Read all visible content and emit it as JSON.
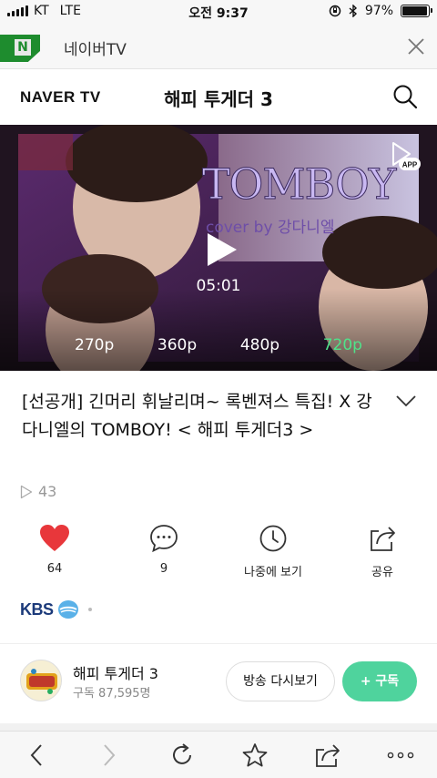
{
  "status_bar": {
    "carrier": "KT",
    "network": "LTE",
    "time": "오전 9:37",
    "battery": "97%",
    "battery_level": 0.97
  },
  "browser": {
    "logo_letter": "N",
    "title": "네이버TV"
  },
  "tv_header": {
    "logo": "NAVER TV",
    "title": "해피 투게더 3"
  },
  "video": {
    "overlay_title": "TOMBOY",
    "overlay_subtitle": "cover by 강다니엘",
    "duration": "05:01",
    "app_badge": "APP",
    "qualities": [
      "270p",
      "360p",
      "480p",
      "720p"
    ],
    "selected_quality": "720p"
  },
  "clip": {
    "title": "[선공개] 긴머리 휘날리며~ 록벤져스 특집! X 강 다니엘의 TOMBOY! < 해피 투게더3 >",
    "views": "43"
  },
  "actions": [
    {
      "name": "like",
      "label": "64"
    },
    {
      "name": "comment",
      "label": "9"
    },
    {
      "name": "watch-later",
      "label": "나중에 보기"
    },
    {
      "name": "share",
      "label": "공유"
    }
  ],
  "broadcaster": "KBS",
  "channel": {
    "name": "해피 투게더 3",
    "subscribers": "구독 87,595명",
    "replay_label": "방송 다시보기",
    "subscribe_label": "+ 구독"
  },
  "colors": {
    "accent_green": "#4fd39d",
    "quality_active": "#4fe38a",
    "like_red": "#e8373b",
    "naver_green": "#1e8c2e"
  },
  "toolbar": [
    "back-icon",
    "forward-icon",
    "refresh-icon",
    "bookmark-star-icon",
    "share-icon",
    "more-icon"
  ]
}
